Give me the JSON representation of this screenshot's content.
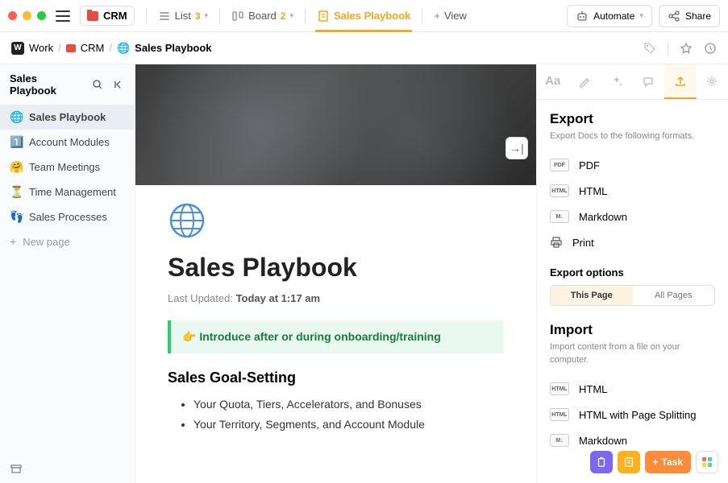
{
  "topbar": {
    "workspace": "CRM",
    "views": [
      {
        "icon": "list",
        "label": "List",
        "count": "3"
      },
      {
        "icon": "board",
        "label": "Board",
        "count": "2"
      },
      {
        "icon": "doc",
        "label": "Sales Playbook",
        "active": true
      }
    ],
    "add_view": "View",
    "automate": "Automate",
    "share": "Share"
  },
  "breadcrumb": {
    "work": "Work",
    "workspace": "CRM",
    "page": "Sales Playbook"
  },
  "sidebar": {
    "title": "Sales Playbook",
    "items": [
      {
        "emoji": "🌐",
        "label": "Sales Playbook",
        "active": true
      },
      {
        "emoji": "1️⃣",
        "label": "Account Modules"
      },
      {
        "emoji": "🤗",
        "label": "Team Meetings"
      },
      {
        "emoji": "⏳",
        "label": "Time Management"
      },
      {
        "emoji": "👣",
        "label": "Sales Processes"
      }
    ],
    "new_page": "New page"
  },
  "document": {
    "title": "Sales Playbook",
    "updated_label": "Last Updated:",
    "updated_value": "Today at 1:17 am",
    "callout": "👉 Introduce after or during onboarding/training",
    "section_heading": "Sales Goal-Setting",
    "bullets": [
      "Your Quota, Tiers, Accelerators, and Bonuses",
      "Your Territory, Segments, and Account Module"
    ]
  },
  "panel": {
    "export_heading": "Export",
    "export_sub": "Export Docs to the following formats.",
    "export_formats": [
      {
        "badge": "PDF",
        "label": "PDF"
      },
      {
        "badge": "HTML",
        "label": "HTML"
      },
      {
        "badge": "M↓",
        "label": "Markdown"
      },
      {
        "badge": "🖨",
        "label": "Print"
      }
    ],
    "export_options": "Export options",
    "seg_this": "This Page",
    "seg_all": "All Pages",
    "import_heading": "Import",
    "import_sub": "Import content from a file on your computer.",
    "import_formats": [
      {
        "badge": "HTML",
        "label": "HTML"
      },
      {
        "badge": "HTML",
        "label": "HTML with Page Splitting"
      },
      {
        "badge": "M↓",
        "label": "Markdown"
      }
    ]
  },
  "floating": {
    "task": "Task"
  }
}
